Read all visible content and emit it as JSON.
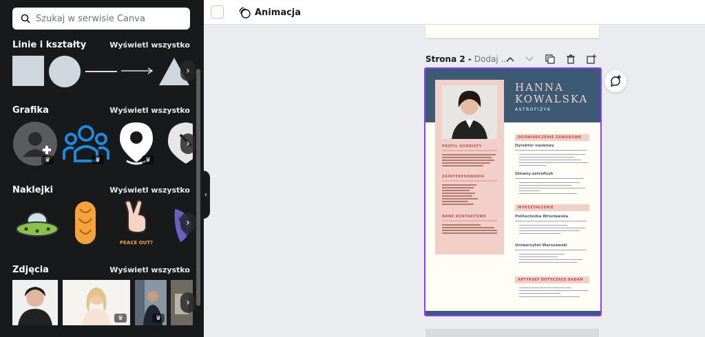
{
  "search": {
    "placeholder": "Szukaj w serwisie Canva"
  },
  "sections": {
    "lines": {
      "title": "Linie i kształty",
      "see_all": "Wyświetl wszystko"
    },
    "graphics": {
      "title": "Grafika",
      "see_all": "Wyświetl wszystko"
    },
    "stickers": {
      "title": "Naklejki",
      "see_all": "Wyświetl wszystko",
      "peace_text": "PEACE OUT?"
    },
    "photos": {
      "title": "Zdjęcia",
      "see_all": "Wyświetl wszystko"
    }
  },
  "toolbar": {
    "animation": "Animacja"
  },
  "page2": {
    "label": "Strona 2 -",
    "add_title": "Dodaj ..."
  },
  "resume": {
    "first_name": "HANNA",
    "last_name": "KOWALSKA",
    "role": "ASTROFIZYK",
    "profile": "PROFIL OSOBISTY",
    "interests": "ZAINTERESOWANIA",
    "contact": "DANE KONTAKTOWE",
    "experience": "DOŚWIADCZENIE ZAWODOWE",
    "job1": "Dyrektor naukowy",
    "job2": "Główny astrofizyk",
    "education": "WYKSZTAŁCENIE",
    "school1": "Politechnika Wrocławska",
    "school2": "Uniwersytet Warszawski",
    "articles": "ARTYKUŁY DOTYCZĄCE BADAŃ"
  },
  "colors": {
    "panel": "#18191b",
    "accent": "#8b3dff",
    "resume_navy": "#3d5a75",
    "resume_pink": "#f2cfc8"
  }
}
